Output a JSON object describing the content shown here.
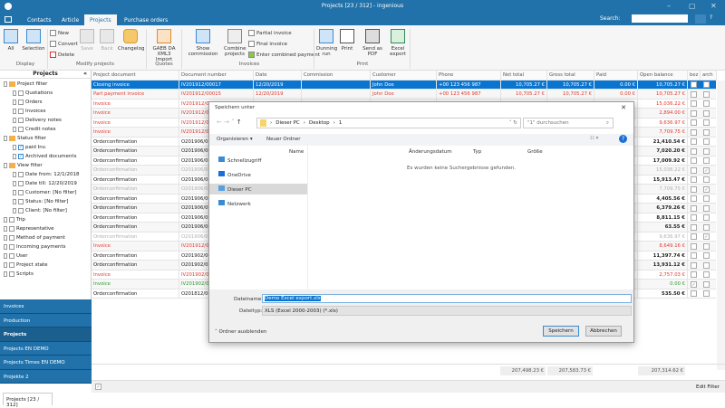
{
  "window": {
    "title": "Projects [23 / 312] - ingenious",
    "minimize": "–",
    "maximize": "▢",
    "close": "✕"
  },
  "tabs": [
    "Contacts",
    "Article",
    "Projects",
    "Purchase orders"
  ],
  "search": {
    "label": "Search:",
    "value": "",
    "help": "?"
  },
  "ribbon": {
    "display": {
      "all": "All",
      "selection": "Selection",
      "group": "Display"
    },
    "modify": {
      "new": "New",
      "convert": "Convert",
      "delete": "Delete",
      "save": "Save",
      "back": "Back",
      "changelog": "Changelog",
      "group": "Modify projects"
    },
    "quotes": {
      "gaeb": "GAEB DA XML3 Import",
      "group": "Quotes"
    },
    "invoices": {
      "show_commission": "Show commission",
      "combine": "Combine projects",
      "partial": "Partial invoice",
      "final": "Final invoice",
      "combined_payment": "Enter combined payment",
      "group": "Invoices"
    },
    "print": {
      "dunning": "Dunning run",
      "print": "Print",
      "send_pdf": "Send as PDF",
      "excel": "Excel export",
      "group": "Print"
    }
  },
  "left_panel": {
    "title": "Projects",
    "collapse": "«",
    "tree": [
      {
        "label": "Project filter",
        "level": 0,
        "icon": "folder"
      },
      {
        "label": "Quotations",
        "level": 1,
        "icon": "doc"
      },
      {
        "label": "Orders",
        "level": 1,
        "icon": "doc"
      },
      {
        "label": "Invoices",
        "level": 1,
        "icon": "doc"
      },
      {
        "label": "Delivery notes",
        "level": 1,
        "icon": "doc"
      },
      {
        "label": "Credit notes",
        "level": 1,
        "icon": "doc"
      },
      {
        "label": "Status filter",
        "level": 0,
        "icon": "folder"
      },
      {
        "label": "paid Inv.",
        "level": 1,
        "icon": "check"
      },
      {
        "label": "Archived documents",
        "level": 1,
        "icon": "check"
      },
      {
        "label": "View filter",
        "level": 0,
        "icon": "folder"
      },
      {
        "label": "Date from: 12/1/2018",
        "level": 1,
        "icon": "cal"
      },
      {
        "label": "Date till: 12/20/2019",
        "level": 1,
        "icon": "cal"
      },
      {
        "label": "Customer: [No filter]",
        "level": 1,
        "icon": "user"
      },
      {
        "label": "Status: [No filter]",
        "level": 1,
        "icon": "doc"
      },
      {
        "label": "Client: [No filter]",
        "level": 1,
        "icon": "user"
      },
      {
        "label": "Trip",
        "level": 0,
        "icon": "doc"
      },
      {
        "label": "Representative",
        "level": 0,
        "icon": "doc"
      },
      {
        "label": "Method of payment",
        "level": 0,
        "icon": "doc"
      },
      {
        "label": "Incoming payments",
        "level": 0,
        "icon": "doc"
      },
      {
        "label": "User",
        "level": 0,
        "icon": "user"
      },
      {
        "label": "Project state",
        "level": 0,
        "icon": "doc"
      },
      {
        "label": "Scripts",
        "level": 0,
        "icon": "doc"
      }
    ]
  },
  "nav": [
    "Invoices",
    "Production",
    "Projects",
    "Projects EN DEMO",
    "Projects Times EN DEMO",
    "Projekte 2"
  ],
  "bottom_tab": "Projects [23 / 312]",
  "grid": {
    "columns": [
      "Project document",
      "Document number",
      "Date",
      "Commission",
      "Customer",
      "Phone",
      "Net total",
      "Gross total",
      "Paid",
      "Open balance",
      "bez",
      "arch"
    ],
    "rows": [
      {
        "doc": "Closing invoice",
        "num": "IV201912/00017",
        "date": "12/20/2019",
        "customer": "John Doe",
        "phone": "+00 123 456 987",
        "net": "10,705.27 €",
        "gross": "10,705.27 €",
        "paid": "0.00 €",
        "open": "10,705.27 €",
        "bez": false,
        "arch": false,
        "style": "sel"
      },
      {
        "doc": "Part payment invoice",
        "num": "IV201912/00015",
        "date": "12/20/2019",
        "customer": "John Doe",
        "phone": "+00 123 456 987",
        "net": "10,705.27 €",
        "gross": "10,705.27 €",
        "paid": "0.00 €",
        "open": "10,705.27 €",
        "bez": false,
        "arch": false,
        "style": "red"
      },
      {
        "doc": "Invoice",
        "num": "IV201912/00",
        "open": "15,036.22 €",
        "bez": false,
        "arch": false,
        "style": "red"
      },
      {
        "doc": "Invoice",
        "num": "IV201912/00",
        "open": "2,894.00 €",
        "bez": false,
        "arch": false,
        "style": "red"
      },
      {
        "doc": "Invoice",
        "num": "IV201912/00",
        "open": "9,636.97 €",
        "bez": false,
        "arch": false,
        "style": "red"
      },
      {
        "doc": "Invoice",
        "num": "IV201912/00",
        "open": "7,709.75 €",
        "bez": false,
        "arch": false,
        "style": "red"
      },
      {
        "doc": "Orderconfirmation",
        "num": "O201906/00",
        "open": "21,410.54 €",
        "bez": false,
        "arch": false,
        "style": "normal"
      },
      {
        "doc": "Orderconfirmation",
        "num": "O201906/00",
        "open": "7,020.20 €",
        "bez": false,
        "arch": false,
        "style": "normal"
      },
      {
        "doc": "Orderconfirmation",
        "num": "O201906/00",
        "open": "17,009.92 €",
        "bez": false,
        "arch": false,
        "style": "normal"
      },
      {
        "doc": "Orderconfirmation",
        "num": "O201906/00",
        "open": "15,036.22 €",
        "bez": false,
        "arch": true,
        "style": "gray"
      },
      {
        "doc": "Orderconfirmation",
        "num": "O201906/00",
        "open": "15,913.47 €",
        "bez": false,
        "arch": false,
        "style": "normal"
      },
      {
        "doc": "Orderconfirmation",
        "num": "O201906/00",
        "open": "7,709.75 €",
        "bez": false,
        "arch": true,
        "style": "gray"
      },
      {
        "doc": "Orderconfirmation",
        "num": "O201906/00",
        "open": "4,405.56 €",
        "bez": false,
        "arch": false,
        "style": "normal"
      },
      {
        "doc": "Orderconfirmation",
        "num": "O201906/00",
        "open": "6,379.26 €",
        "bez": false,
        "arch": false,
        "style": "normal"
      },
      {
        "doc": "Orderconfirmation",
        "num": "O201906/00",
        "open": "8,811.15 €",
        "bez": false,
        "arch": false,
        "style": "normal"
      },
      {
        "doc": "Orderconfirmation",
        "num": "O201906/00",
        "open": "63.55 €",
        "bez": false,
        "arch": false,
        "style": "normal"
      },
      {
        "doc": "Orderconfirmation",
        "num": "O201906/00",
        "open": "9,636.97 €",
        "bez": false,
        "arch": true,
        "style": "gray"
      },
      {
        "doc": "Invoice",
        "num": "IV201912/00",
        "open": "8,649.16 €",
        "bez": false,
        "arch": false,
        "style": "red"
      },
      {
        "doc": "Orderconfirmation",
        "num": "O201902/00",
        "open": "11,397.74 €",
        "bez": false,
        "arch": false,
        "style": "normal"
      },
      {
        "doc": "Orderconfirmation",
        "num": "O201902/00",
        "open": "13,931.12 €",
        "bez": false,
        "arch": false,
        "style": "normal"
      },
      {
        "doc": "Invoice",
        "num": "IV201902/00",
        "open": "2,757.03 €",
        "bez": false,
        "arch": false,
        "style": "red"
      },
      {
        "doc": "Invoice",
        "num": "IV201902/00",
        "open": "0.00 €",
        "bez": true,
        "arch": false,
        "style": "green"
      },
      {
        "doc": "Orderconfirmation",
        "num": "O201812/00",
        "open": "535.50 €",
        "bez": false,
        "arch": false,
        "style": "normal"
      }
    ],
    "totals": {
      "net": "207,498.23 €",
      "gross": "207,583.73 €",
      "open": "207,314.62 €"
    },
    "edit_filter": "Edit Filter"
  },
  "colors": {
    "brand": "#2172aa",
    "red": "#e03a2f",
    "green": "#2e9a2e",
    "gray": "#b0b0b0",
    "select": "#0a75d0"
  },
  "dialog": {
    "title": "Speichern unter",
    "close": "✕",
    "breadcrumb": [
      "Dieser PC",
      "Desktop",
      "1"
    ],
    "search_placeholder": "\"1\" durchsuchen",
    "organize": "Organisieren ▾",
    "new_folder": "Neuer Ordner",
    "nav": [
      "Schnellzugriff",
      "OneDrive",
      "Dieser PC",
      "Netzwerk"
    ],
    "columns": [
      "Name",
      "Änderungsdatum",
      "Typ",
      "Größe"
    ],
    "empty": "Es wurden keine Suchergebnisse gefunden.",
    "filename_label": "Dateiname:",
    "filename": "Demo Excel export.xls",
    "filetype_label": "Dateityp:",
    "filetype": "XLS (Excel 2000-2003) (*.xls)",
    "hide_folders": "Ordner ausblenden",
    "save": "Speichern",
    "cancel": "Abbrechen"
  }
}
